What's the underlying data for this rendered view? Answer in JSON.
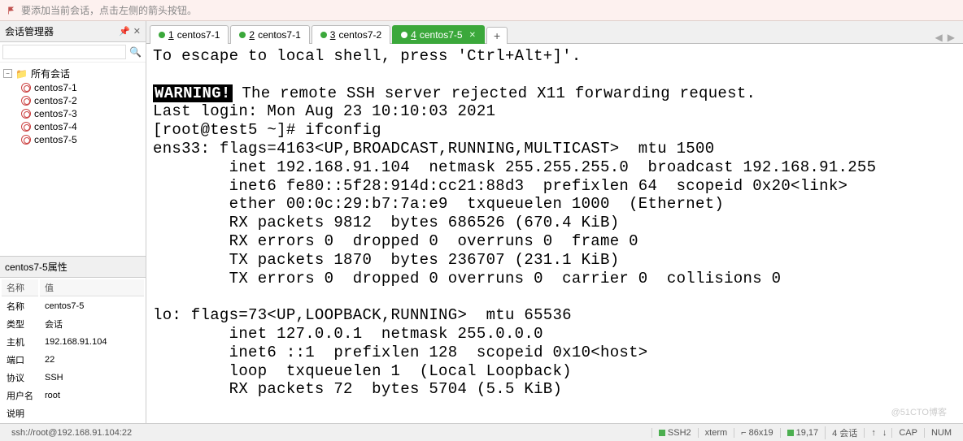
{
  "hint": "要添加当前会话，点击左侧的箭头按钮。",
  "session_manager": {
    "title": "会话管理器",
    "search_placeholder": "",
    "root": "所有会话",
    "sessions": [
      "centos7-1",
      "centos7-2",
      "centos7-3",
      "centos7-4",
      "centos7-5"
    ]
  },
  "properties": {
    "title": "centos7-5属性",
    "header_name": "名称",
    "header_value": "值",
    "rows": [
      {
        "k": "名称",
        "v": "centos7-5"
      },
      {
        "k": "类型",
        "v": "会话"
      },
      {
        "k": "主机",
        "v": "192.168.91.104"
      },
      {
        "k": "端口",
        "v": "22"
      },
      {
        "k": "协议",
        "v": "SSH"
      },
      {
        "k": "用户名",
        "v": "root"
      },
      {
        "k": "说明",
        "v": ""
      }
    ]
  },
  "tabs": [
    {
      "num": "1",
      "label": "centos7-1",
      "active": false
    },
    {
      "num": "2",
      "label": "centos7-1",
      "active": false
    },
    {
      "num": "3",
      "label": "centos7-2",
      "active": false
    },
    {
      "num": "4",
      "label": "centos7-5",
      "active": true
    }
  ],
  "terminal": {
    "line_escape": "To escape to local shell, press 'Ctrl+Alt+]'.",
    "warn_label": "WARNING!",
    "warn_text": " The remote SSH server rejected X11 forwarding request.",
    "login": "Last login: Mon Aug 23 10:10:03 2021",
    "prompt": "[root@test5 ~]# ifconfig",
    "if1": "ens33: flags=4163<UP,BROADCAST,RUNNING,MULTICAST>  mtu 1500",
    "if1_inet": "        inet 192.168.91.104  netmask 255.255.255.0  broadcast 192.168.91.255",
    "if1_inet6": "        inet6 fe80::5f28:914d:cc21:88d3  prefixlen 64  scopeid 0x20<link>",
    "if1_ether": "        ether 00:0c:29:b7:7a:e9  txqueuelen 1000  (Ethernet)",
    "if1_rxp": "        RX packets 9812  bytes 686526 (670.4 KiB)",
    "if1_rxe": "        RX errors 0  dropped 0  overruns 0  frame 0",
    "if1_txp": "        TX packets 1870  bytes 236707 (231.1 KiB)",
    "if1_txe": "        TX errors 0  dropped 0 overruns 0  carrier 0  collisions 0",
    "if2": "lo: flags=73<UP,LOOPBACK,RUNNING>  mtu 65536",
    "if2_inet": "        inet 127.0.0.1  netmask 255.0.0.0",
    "if2_inet6": "        inet6 ::1  prefixlen 128  scopeid 0x10<host>",
    "if2_loop": "        loop  txqueuelen 1  (Local Loopback)",
    "if2_rxp": "        RX packets 72  bytes 5704 (5.5 KiB)"
  },
  "status": {
    "left": "ssh://root@192.168.91.104:22",
    "ssh": "SSH2",
    "term": "xterm",
    "size": "⌐ 86x19",
    "pos": "19,17",
    "sess": "4 会话",
    "nav_up": "↑",
    "nav_down": "↓",
    "cap": "CAP",
    "num": "NUM"
  },
  "watermark": "@51CTO博客"
}
